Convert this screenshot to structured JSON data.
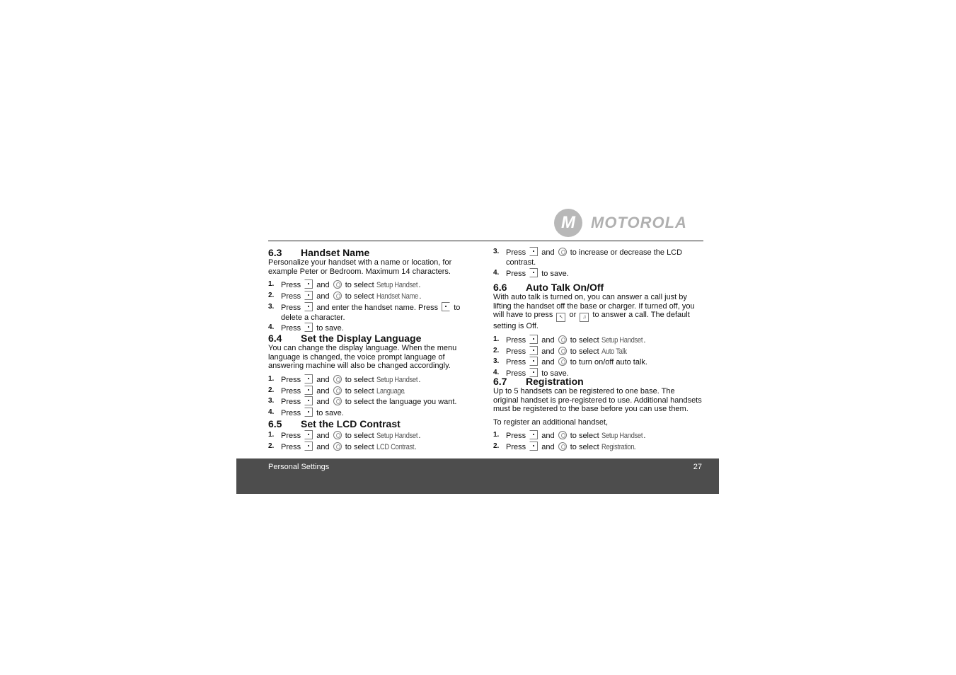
{
  "brand": {
    "logo_text": "MOTOROLA"
  },
  "left": {
    "s63": {
      "num": "6.3",
      "title": "Handset Name",
      "para": "Personalize your handset with a name or location, for example Peter or Bedroom. Maximum 14 characters.",
      "steps": [
        [
          {
            "t": "Press "
          },
          {
            "i": "menu-key"
          },
          {
            "t": " and "
          },
          {
            "i": "nav-key"
          },
          {
            "t": " to select "
          },
          {
            "m": "Setup Handset"
          },
          {
            "t": "."
          }
        ],
        [
          {
            "t": "Press "
          },
          {
            "i": "menu-key"
          },
          {
            "t": " and "
          },
          {
            "i": "nav-key"
          },
          {
            "t": " to select "
          },
          {
            "m": "Handset Name"
          },
          {
            "t": "."
          }
        ],
        [
          {
            "t": "Press "
          },
          {
            "i": "menu-key"
          },
          {
            "t": " and enter the handset name. Press "
          },
          {
            "i": "delete-key"
          },
          {
            "t": " to delete a character."
          }
        ],
        [
          {
            "t": "Press "
          },
          {
            "i": "menu-key"
          },
          {
            "t": " to save."
          }
        ]
      ]
    },
    "s64": {
      "num": "6.4",
      "title": "Set the Display Language",
      "para": "You can change the display language. When the menu language is changed, the voice prompt language of answering machine will also be changed accordingly.",
      "steps": [
        [
          {
            "t": "Press "
          },
          {
            "i": "menu-key"
          },
          {
            "t": " and "
          },
          {
            "i": "nav-key"
          },
          {
            "t": " to select "
          },
          {
            "m": "Setup Handset"
          },
          {
            "t": "."
          }
        ],
        [
          {
            "t": "Press "
          },
          {
            "i": "menu-key"
          },
          {
            "t": " and "
          },
          {
            "i": "nav-key"
          },
          {
            "t": " to select "
          },
          {
            "m": "Language"
          },
          {
            "t": "."
          }
        ],
        [
          {
            "t": "Press "
          },
          {
            "i": "menu-key"
          },
          {
            "t": " and "
          },
          {
            "i": "nav-key"
          },
          {
            "t": " to select the language you want."
          }
        ],
        [
          {
            "t": "Press "
          },
          {
            "i": "menu-key"
          },
          {
            "t": " to save."
          }
        ]
      ]
    },
    "s65": {
      "num": "6.5",
      "title": "Set the LCD Contrast",
      "steps": [
        [
          {
            "t": "Press "
          },
          {
            "i": "menu-key"
          },
          {
            "t": " and "
          },
          {
            "i": "nav-key"
          },
          {
            "t": " to select "
          },
          {
            "m": "Setup Handset"
          },
          {
            "t": "."
          }
        ],
        [
          {
            "t": "Press "
          },
          {
            "i": "menu-key"
          },
          {
            "t": " and "
          },
          {
            "i": "nav-key"
          },
          {
            "t": " to select "
          },
          {
            "m": "LCD Contrast"
          },
          {
            "t": "."
          }
        ]
      ]
    }
  },
  "right": {
    "s65cont": {
      "start": 3,
      "steps": [
        [
          {
            "t": "Press "
          },
          {
            "i": "menu-key"
          },
          {
            "t": " and "
          },
          {
            "i": "nav-key"
          },
          {
            "t": " to increase or decrease the LCD contrast."
          }
        ],
        [
          {
            "t": "Press "
          },
          {
            "i": "menu-key"
          },
          {
            "t": " to save."
          }
        ]
      ]
    },
    "s66": {
      "num": "6.6",
      "title": "Auto Talk On/Off",
      "para": [
        {
          "t": "With auto talk is turned on, you can answer a call just by lifting the handset off the base or charger. If turned off, you will have to press "
        },
        {
          "i": "talk-key"
        },
        {
          "t": " or "
        },
        {
          "i": "speaker-key"
        },
        {
          "t": " to answer a call. The default setting is Off."
        }
      ],
      "steps": [
        [
          {
            "t": "Press "
          },
          {
            "i": "menu-key"
          },
          {
            "t": " and "
          },
          {
            "i": "nav-key"
          },
          {
            "t": " to select "
          },
          {
            "m": "Setup Handset"
          },
          {
            "t": "."
          }
        ],
        [
          {
            "t": "Press "
          },
          {
            "i": "menu-key"
          },
          {
            "t": " and "
          },
          {
            "i": "nav-key"
          },
          {
            "t": " to select "
          },
          {
            "m": "Auto Talk"
          },
          {
            "t": "."
          }
        ],
        [
          {
            "t": "Press "
          },
          {
            "i": "menu-key"
          },
          {
            "t": " and "
          },
          {
            "i": "nav-key"
          },
          {
            "t": " to turn on/off auto talk."
          }
        ],
        [
          {
            "t": "Press "
          },
          {
            "i": "menu-key"
          },
          {
            "t": " to save."
          }
        ]
      ]
    },
    "s67": {
      "num": "6.7",
      "title": "Registration",
      "para": "Up to 5 handsets can be registered to one base. The original handset is pre-registered to use. Additional handsets must be registered to the base before you can use them.",
      "para2": "To register an additional handset,",
      "steps": [
        [
          {
            "t": "Press "
          },
          {
            "i": "menu-key"
          },
          {
            "t": " and "
          },
          {
            "i": "nav-key"
          },
          {
            "t": " to select "
          },
          {
            "m": "Setup Handset"
          },
          {
            "t": "."
          }
        ],
        [
          {
            "t": "Press "
          },
          {
            "i": "menu-key"
          },
          {
            "t": " and "
          },
          {
            "i": "nav-key"
          },
          {
            "t": " to select "
          },
          {
            "m": "Registration"
          },
          {
            "t": "."
          }
        ]
      ]
    }
  },
  "footer": {
    "section": "Personal Settings",
    "page": "27"
  }
}
